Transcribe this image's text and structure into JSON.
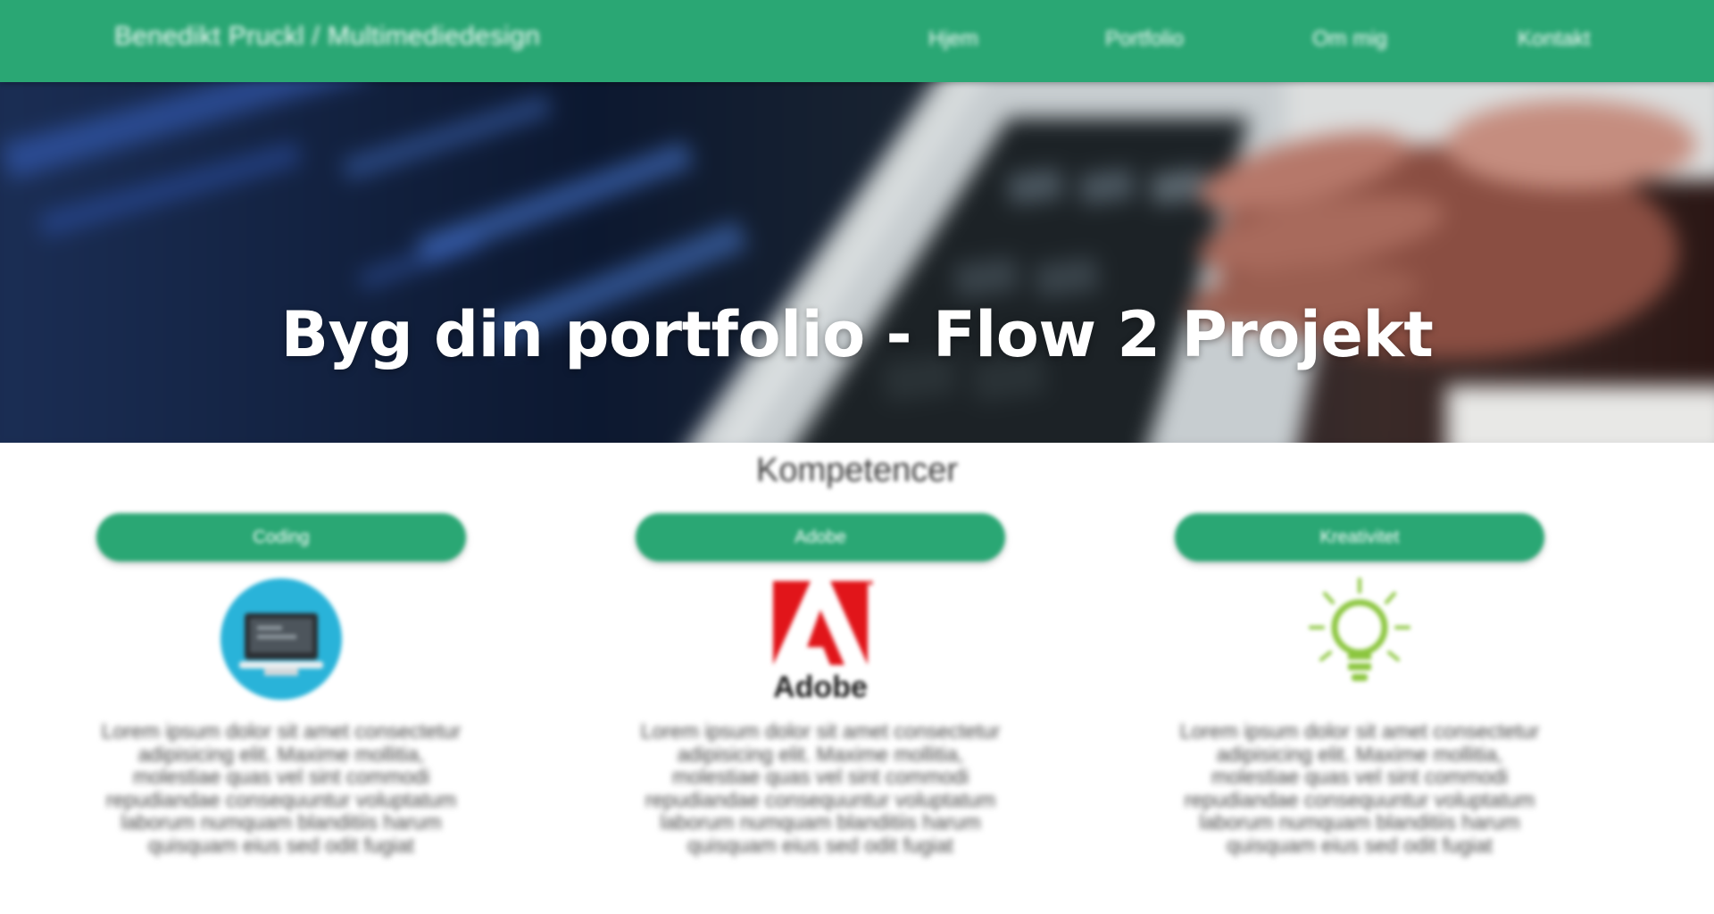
{
  "nav": {
    "brand": "Benedikt Pruckl / Multimediedesign",
    "links": [
      "Hjem",
      "Portfolio",
      "Om mig",
      "Kontakt"
    ]
  },
  "hero": {
    "title": "Byg din portfolio - Flow 2 Projekt"
  },
  "section": {
    "title": "Kompetencer"
  },
  "competences": [
    {
      "label": "Coding",
      "icon": "computer-icon",
      "text": "Lorem ipsum dolor sit amet consectetur adipisicing elit. Maxime mollitia, molestiae quas vel sint commodi repudiandae consequuntur voluptatum laborum numquam blanditiis harum quisquam eius sed odit fugiat"
    },
    {
      "label": "Adobe",
      "icon": "adobe-logo",
      "logo_text": "Adobe",
      "text": "Lorem ipsum dolor sit amet consectetur adipisicing elit. Maxime mollitia, molestiae quas vel sint commodi repudiandae consequuntur voluptatum laborum numquam blanditiis harum quisquam eius sed odit fugiat"
    },
    {
      "label": "Kreativitet",
      "icon": "lightbulb-icon",
      "text": "Lorem ipsum dolor sit amet consectetur adipisicing elit. Maxime mollitia, molestiae quas vel sint commodi repudiandae consequuntur voluptatum laborum numquam blanditiis harum quisquam eius sed odit fugiat"
    }
  ],
  "colors": {
    "brand_green": "#2aa774",
    "computer_blue": "#29b3d9",
    "adobe_red": "#e1151a",
    "bulb_green": "#8cc63f"
  }
}
